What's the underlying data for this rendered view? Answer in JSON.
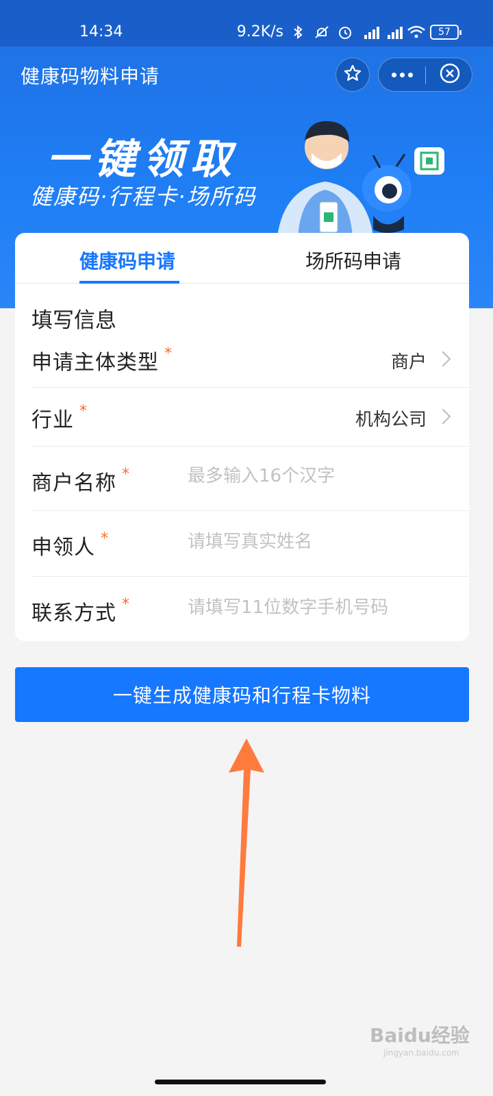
{
  "status": {
    "time": "14:34",
    "speed": "9.2K/s",
    "battery": "57"
  },
  "header": {
    "title": "健康码物料申请"
  },
  "banner": {
    "title": "一键领取",
    "subtitle": "健康码·行程卡·场所码"
  },
  "tabs": [
    {
      "label": "健康码申请",
      "active": true
    },
    {
      "label": "场所码申请",
      "active": false
    }
  ],
  "form": {
    "section_title": "填写信息",
    "required_mark": "*",
    "fields": [
      {
        "label": "申请主体类型",
        "value": "商户"
      },
      {
        "label": "行业",
        "value": "机构公司"
      },
      {
        "label": "商户名称",
        "placeholder": "最多输入16个汉字"
      },
      {
        "label": "申领人",
        "placeholder": "请填写真实姓名"
      },
      {
        "label": "联系方式",
        "placeholder": "请填写11位数字手机号码"
      }
    ]
  },
  "submit": {
    "label": "一键生成健康码和行程卡物料"
  },
  "watermark": {
    "text": "Baidu经验",
    "url": "jingyan.baidu.com"
  },
  "colors": {
    "primary": "#1677ff",
    "header_blue": "#1f7ef5",
    "required": "#ff6a2a",
    "arrow": "#ff7a3d"
  }
}
